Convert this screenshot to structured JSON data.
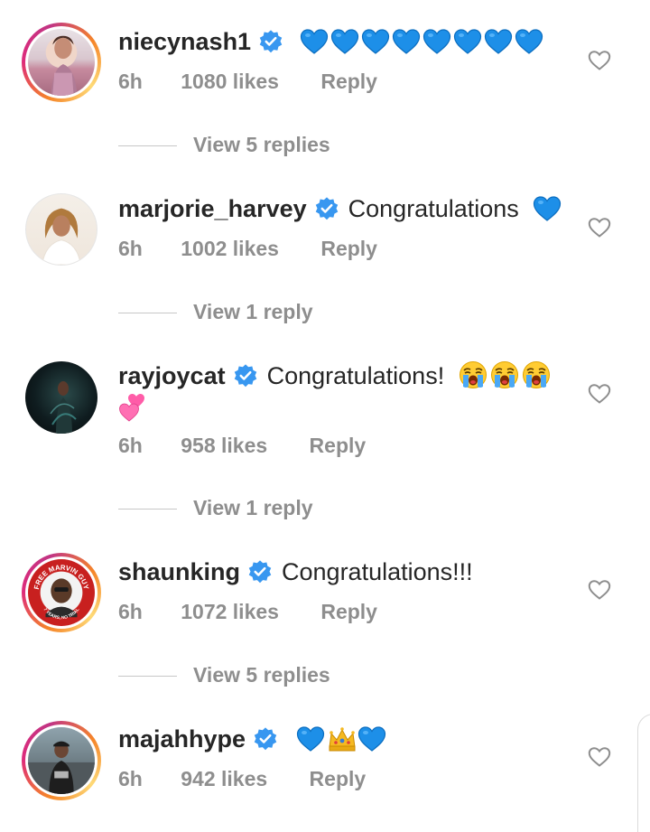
{
  "comments": [
    {
      "username": "niecynash1",
      "text": "",
      "emoji": "blue-heart x8",
      "time": "6h",
      "likes": "1080 likes",
      "reply": "Reply",
      "view_replies": "View 5 replies"
    },
    {
      "username": "marjorie_harvey",
      "text": "Congratulations",
      "emoji": "blue-heart",
      "time": "6h",
      "likes": "1002 likes",
      "reply": "Reply",
      "view_replies": "View 1 reply"
    },
    {
      "username": "rayjoycat",
      "text": "Congratulations!",
      "emoji": "loudly-crying-face x3, two-hearts",
      "time": "6h",
      "likes": "958 likes",
      "reply": "Reply",
      "view_replies": "View 1 reply"
    },
    {
      "username": "shaunking",
      "text": "Congratulations!!!",
      "emoji": "",
      "time": "6h",
      "likes": "1072 likes",
      "reply": "Reply",
      "view_replies": "View 5 replies"
    },
    {
      "username": "majahhype",
      "text": "",
      "emoji": "blue-heart, crown, blue-heart",
      "time": "6h",
      "likes": "942 likes",
      "reply": "Reply"
    }
  ],
  "avatar_badge_text": {
    "top": "FREE MARVIN GUY",
    "bottom": "7 YEARS, NO TRIAL"
  },
  "colors": {
    "verified_blue": "#3897f0",
    "meta_gray": "#8e8e8e",
    "text_dark": "#262626",
    "blue_heart": "#1d8fe8"
  }
}
